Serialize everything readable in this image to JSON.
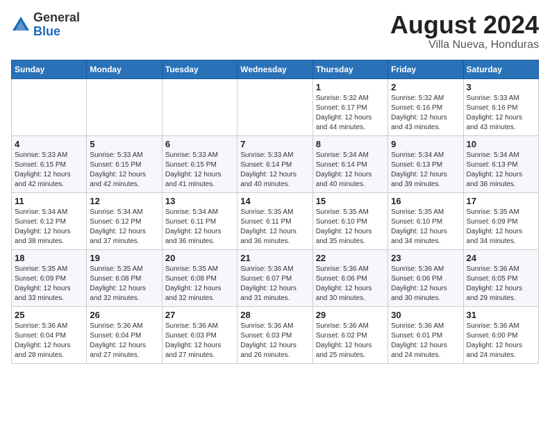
{
  "logo": {
    "general": "General",
    "blue": "Blue"
  },
  "title": "August 2024",
  "subtitle": "Villa Nueva, Honduras",
  "days_of_week": [
    "Sunday",
    "Monday",
    "Tuesday",
    "Wednesday",
    "Thursday",
    "Friday",
    "Saturday"
  ],
  "weeks": [
    [
      {
        "day": "",
        "info": ""
      },
      {
        "day": "",
        "info": ""
      },
      {
        "day": "",
        "info": ""
      },
      {
        "day": "",
        "info": ""
      },
      {
        "day": "1",
        "info": "Sunrise: 5:32 AM\nSunset: 6:17 PM\nDaylight: 12 hours\nand 44 minutes."
      },
      {
        "day": "2",
        "info": "Sunrise: 5:32 AM\nSunset: 6:16 PM\nDaylight: 12 hours\nand 43 minutes."
      },
      {
        "day": "3",
        "info": "Sunrise: 5:33 AM\nSunset: 6:16 PM\nDaylight: 12 hours\nand 43 minutes."
      }
    ],
    [
      {
        "day": "4",
        "info": "Sunrise: 5:33 AM\nSunset: 6:15 PM\nDaylight: 12 hours\nand 42 minutes."
      },
      {
        "day": "5",
        "info": "Sunrise: 5:33 AM\nSunset: 6:15 PM\nDaylight: 12 hours\nand 42 minutes."
      },
      {
        "day": "6",
        "info": "Sunrise: 5:33 AM\nSunset: 6:15 PM\nDaylight: 12 hours\nand 41 minutes."
      },
      {
        "day": "7",
        "info": "Sunrise: 5:33 AM\nSunset: 6:14 PM\nDaylight: 12 hours\nand 40 minutes."
      },
      {
        "day": "8",
        "info": "Sunrise: 5:34 AM\nSunset: 6:14 PM\nDaylight: 12 hours\nand 40 minutes."
      },
      {
        "day": "9",
        "info": "Sunrise: 5:34 AM\nSunset: 6:13 PM\nDaylight: 12 hours\nand 39 minutes."
      },
      {
        "day": "10",
        "info": "Sunrise: 5:34 AM\nSunset: 6:13 PM\nDaylight: 12 hours\nand 38 minutes."
      }
    ],
    [
      {
        "day": "11",
        "info": "Sunrise: 5:34 AM\nSunset: 6:12 PM\nDaylight: 12 hours\nand 38 minutes."
      },
      {
        "day": "12",
        "info": "Sunrise: 5:34 AM\nSunset: 6:12 PM\nDaylight: 12 hours\nand 37 minutes."
      },
      {
        "day": "13",
        "info": "Sunrise: 5:34 AM\nSunset: 6:11 PM\nDaylight: 12 hours\nand 36 minutes."
      },
      {
        "day": "14",
        "info": "Sunrise: 5:35 AM\nSunset: 6:11 PM\nDaylight: 12 hours\nand 36 minutes."
      },
      {
        "day": "15",
        "info": "Sunrise: 5:35 AM\nSunset: 6:10 PM\nDaylight: 12 hours\nand 35 minutes."
      },
      {
        "day": "16",
        "info": "Sunrise: 5:35 AM\nSunset: 6:10 PM\nDaylight: 12 hours\nand 34 minutes."
      },
      {
        "day": "17",
        "info": "Sunrise: 5:35 AM\nSunset: 6:09 PM\nDaylight: 12 hours\nand 34 minutes."
      }
    ],
    [
      {
        "day": "18",
        "info": "Sunrise: 5:35 AM\nSunset: 6:09 PM\nDaylight: 12 hours\nand 33 minutes."
      },
      {
        "day": "19",
        "info": "Sunrise: 5:35 AM\nSunset: 6:08 PM\nDaylight: 12 hours\nand 32 minutes."
      },
      {
        "day": "20",
        "info": "Sunrise: 5:35 AM\nSunset: 6:08 PM\nDaylight: 12 hours\nand 32 minutes."
      },
      {
        "day": "21",
        "info": "Sunrise: 5:36 AM\nSunset: 6:07 PM\nDaylight: 12 hours\nand 31 minutes."
      },
      {
        "day": "22",
        "info": "Sunrise: 5:36 AM\nSunset: 6:06 PM\nDaylight: 12 hours\nand 30 minutes."
      },
      {
        "day": "23",
        "info": "Sunrise: 5:36 AM\nSunset: 6:06 PM\nDaylight: 12 hours\nand 30 minutes."
      },
      {
        "day": "24",
        "info": "Sunrise: 5:36 AM\nSunset: 6:05 PM\nDaylight: 12 hours\nand 29 minutes."
      }
    ],
    [
      {
        "day": "25",
        "info": "Sunrise: 5:36 AM\nSunset: 6:04 PM\nDaylight: 12 hours\nand 28 minutes."
      },
      {
        "day": "26",
        "info": "Sunrise: 5:36 AM\nSunset: 6:04 PM\nDaylight: 12 hours\nand 27 minutes."
      },
      {
        "day": "27",
        "info": "Sunrise: 5:36 AM\nSunset: 6:03 PM\nDaylight: 12 hours\nand 27 minutes."
      },
      {
        "day": "28",
        "info": "Sunrise: 5:36 AM\nSunset: 6:03 PM\nDaylight: 12 hours\nand 26 minutes."
      },
      {
        "day": "29",
        "info": "Sunrise: 5:36 AM\nSunset: 6:02 PM\nDaylight: 12 hours\nand 25 minutes."
      },
      {
        "day": "30",
        "info": "Sunrise: 5:36 AM\nSunset: 6:01 PM\nDaylight: 12 hours\nand 24 minutes."
      },
      {
        "day": "31",
        "info": "Sunrise: 5:36 AM\nSunset: 6:00 PM\nDaylight: 12 hours\nand 24 minutes."
      }
    ]
  ]
}
